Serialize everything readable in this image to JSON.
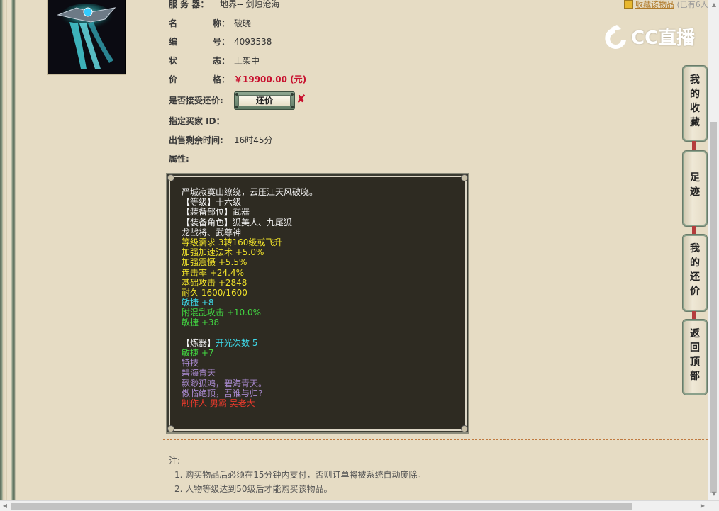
{
  "fields": {
    "server_label": "服 务 器：",
    "server_value": "地界-- 剑烛沧海",
    "name_label_a": "名",
    "name_label_b": "称：",
    "name_value": "破晓",
    "id_label_a": "编",
    "id_label_b": "号：",
    "id_value": "4093538",
    "status_label_a": "状",
    "status_label_b": "态：",
    "status_value": "上架中",
    "price_label_a": "价",
    "price_label_b": "格：",
    "price_value": "￥19900.00 (元)",
    "counter_label": "是否接受还价:",
    "counter_button": "还价",
    "counter_x": "✘",
    "buyer_label": "指定买家 ID：",
    "time_label": "出售剩余时间:",
    "time_value": "16时45分",
    "attr_label": "属性:"
  },
  "attributes": [
    {
      "text": "严城寂寞山缭绕，云压江天风破晓。",
      "color": "white"
    },
    {
      "text": "【等级】十六级",
      "color": "white"
    },
    {
      "text": "【装备部位】武器",
      "color": "white"
    },
    {
      "text": "【装备角色】狐美人、九尾狐",
      "color": "white"
    },
    {
      "text": "龙战将、武尊神",
      "color": "white"
    },
    {
      "text": "等级需求 3转160级或飞升",
      "color": "yellow"
    },
    {
      "text": "加强加速法术 +5.0%",
      "color": "yellow"
    },
    {
      "text": "加强震慑 +5.5%",
      "color": "yellow"
    },
    {
      "text": "连击率 +24.4%",
      "color": "yellow"
    },
    {
      "text": "基础攻击 +2848",
      "color": "yellow"
    },
    {
      "text": "耐久 1600/1600",
      "color": "yellow"
    },
    {
      "text": "敏捷 +8",
      "color": "cyan"
    },
    {
      "text": "附混乱攻击 +10.0%",
      "color": "green"
    },
    {
      "text": "敏捷 +38",
      "color": "green"
    },
    {
      "text": "",
      "color": "white"
    },
    {
      "text_a": "【炼器】",
      "text_b": "开光次数 5",
      "color": "white",
      "color_b": "cyan"
    },
    {
      "text": "敏捷 +7",
      "color": "green"
    },
    {
      "text": "特技",
      "color": "purple"
    },
    {
      "text": "碧海青天",
      "color": "purple"
    },
    {
      "text": "飘渺孤鸿，碧海青天。",
      "color": "purple"
    },
    {
      "text": "傲临绝顶，吾谁与归?",
      "color": "purple"
    },
    {
      "text": "制作人 男霸 吴老大",
      "color": "red"
    }
  ],
  "notes": {
    "title": "注:",
    "items": [
      "1. 购买物品后必须在15分钟内支付，否则订单将被系统自动废除。",
      "2. 人物等级达到50级后才能购买该物品。"
    ]
  },
  "favorite": {
    "link": "收藏该物品",
    "count": "(已有6人"
  },
  "logo": {
    "text": "CC直播"
  },
  "side_nav": [
    {
      "label": "我的收藏"
    },
    {
      "label": "足迹"
    },
    {
      "label": "我的还价"
    },
    {
      "label": "返回顶部"
    }
  ]
}
